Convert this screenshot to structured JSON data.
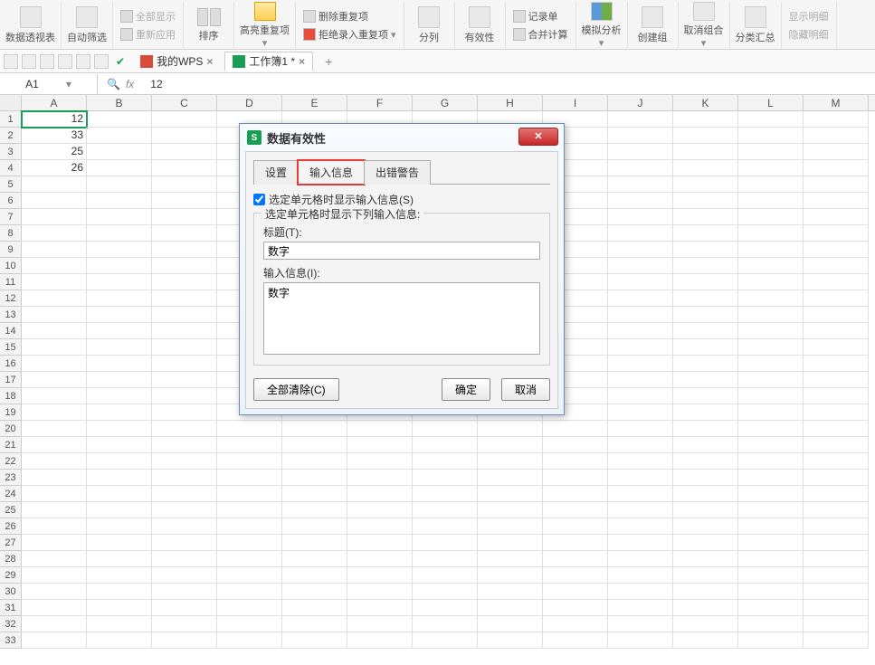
{
  "ribbon": {
    "pivot": "数据透视表",
    "autofilter": "自动筛选",
    "show_all": "全部显示",
    "reapply": "重新应用",
    "sort": "排序",
    "highlight_dup": "高亮重复项",
    "remove_dup": "删除重复项",
    "reject_dup": "拒绝录入重复项",
    "text_to_cols": "分列",
    "validation": "有效性",
    "record_form": "记录单",
    "consolidate": "合并计算",
    "whatif": "模拟分析",
    "create_group": "创建组",
    "ungroup": "取消组合",
    "subtotal": "分类汇总",
    "show_detail": "显示明细",
    "hide_detail": "隐藏明细"
  },
  "tabs": {
    "wps": "我的WPS",
    "workbook": "工作簿1 *"
  },
  "namebox": "A1",
  "formula": "12",
  "columns": [
    "A",
    "B",
    "C",
    "D",
    "E",
    "F",
    "G",
    "H",
    "I",
    "J",
    "K",
    "L",
    "M"
  ],
  "rows": [
    "1",
    "2",
    "3",
    "4",
    "5",
    "6",
    "7",
    "8",
    "9",
    "10",
    "11",
    "12",
    "13",
    "14",
    "15",
    "16",
    "17",
    "18",
    "19",
    "20",
    "21",
    "22",
    "23",
    "24",
    "25",
    "26",
    "27",
    "28",
    "29",
    "30",
    "31",
    "32",
    "33"
  ],
  "data": {
    "A1": "12",
    "A2": "33",
    "A3": "25",
    "A4": "26"
  },
  "dialog": {
    "title": "数据有效性",
    "tab_settings": "设置",
    "tab_input": "输入信息",
    "tab_error": "出错警告",
    "checkbox": "选定单元格时显示输入信息(S)",
    "group_label": "选定单元格时显示下列输入信息:",
    "title_label": "标题(T):",
    "title_value": "数字",
    "msg_label": "输入信息(I):",
    "msg_value": "数字",
    "clear": "全部清除(C)",
    "ok": "确定",
    "cancel": "取消"
  }
}
